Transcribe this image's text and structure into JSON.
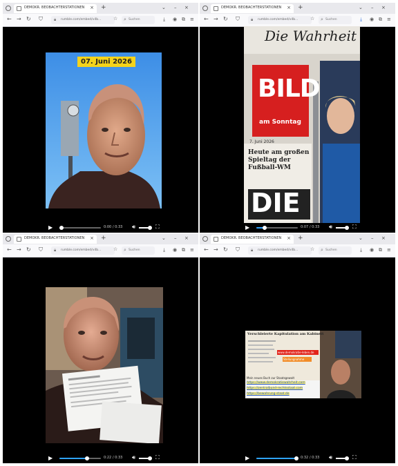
{
  "browser": {
    "tab_title": "DEMOKR. BEOBACHTERSTATIONEN",
    "url": "rumble.com/embed/v4b...",
    "search_placeholder": "Suchen"
  },
  "panes": [
    {
      "id": "top-left",
      "date_label": "07. Juni 2026",
      "time": "0:00 / 0:33",
      "progress": 0.05
    },
    {
      "id": "top-right",
      "newspaper_masthead": "Die Wahrheit",
      "newspaper_logo": "BILD",
      "newspaper_sub": "am Sonntag",
      "newspaper_date": "7. Juni 2026",
      "newspaper_headline": "Heute am großen Spieltag der Fußball-WM",
      "newspaper_big_letters": "DIE",
      "time": "0:07 / 0:33",
      "progress": 0.2
    },
    {
      "id": "bottom-left",
      "time": "0:22 / 0:33",
      "progress": 0.66
    },
    {
      "id": "bottom-right",
      "newsprint_heading": "Verschleierte Kapitulation am Kabinett",
      "banner_red": "www.demokratie-leben.de",
      "banner_orange": "Stellungnahme",
      "video_caption": "Mein neues Buch zur Staatsgewalt",
      "links": [
        "https://www.demokratiewahrheit.com",
        "https://zentralbund-rechtsstaat.com",
        "https://bewahrung-staat.de"
      ],
      "time": "0:32 / 0:33",
      "progress": 0.97
    }
  ],
  "colors": {
    "accent": "#2fa4ff",
    "date_label_bg": "#f5d31b"
  }
}
